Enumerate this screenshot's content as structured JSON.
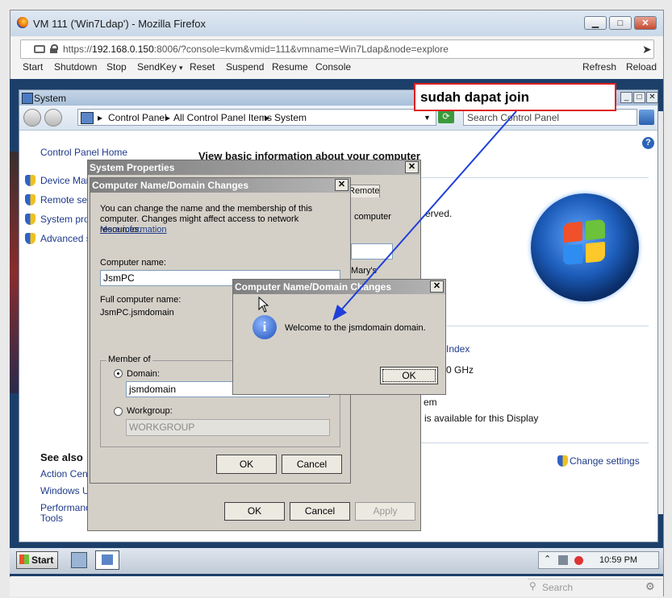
{
  "browser": {
    "window_title": "VM 111 ('Win7Ldap') - Mozilla Firefox",
    "url_prefix": "https://",
    "url_host": "192.168.0.150",
    "url_rest": ":8006/?console=kvm&vmid=111&vmname=Win7Ldap&node=explore",
    "search_placeholder": "Search",
    "buttons": {
      "minimize": "▁",
      "maximize": "□",
      "close": "✕"
    }
  },
  "console_toolbar": {
    "items": [
      "Start",
      "Shutdown",
      "Stop",
      "SendKey",
      "Reset",
      "Suspend",
      "Resume",
      "Console"
    ],
    "right_items": [
      "Refresh",
      "Reload"
    ],
    "sendkey_arrow": "▾"
  },
  "annotation": {
    "text": "sudah dapat join"
  },
  "system_window": {
    "title": "System",
    "breadcrumb": [
      "Control Panel",
      "All Control Panel Items",
      "System"
    ],
    "breadcrumb_sep": "▸",
    "search_placeholder": "Search Control Panel",
    "control_panel_home": "Control Panel Home",
    "left_links": [
      "Device Mana",
      "Remote setti",
      "System prot",
      "Advanced s"
    ],
    "see_also_heading": "See also",
    "see_also_links": [
      "Action Cent",
      "Windows Up",
      "Performance",
      "Tools"
    ],
    "heading": "View basic information about your computer",
    "main_fragments": {
      "reserved": "erved.",
      "index": "Index",
      "ghz": "0 GHz",
      "em": "em",
      "display": "is available for this Display",
      "change_settings": "Change settings"
    },
    "help_icon": "?"
  },
  "system_properties": {
    "title": "System Properties",
    "tab_remote": "Remote",
    "computer_text": "computer",
    "marys_text": "Mary's",
    "ok": "OK",
    "cancel": "Cancel",
    "apply": "Apply",
    "close": "✕"
  },
  "domain_changes": {
    "title": "Computer Name/Domain Changes",
    "description": "You can change the name and the membership of this computer. Changes might affect access to network resources.",
    "more_info": "More information",
    "computer_name_label": "Computer name:",
    "computer_name_value": "JsmPC",
    "full_name_label": "Full computer name:",
    "full_name_value": "JsmPC.jsmdomain",
    "member_of_label": "Member of",
    "domain_label": "Domain:",
    "domain_value": "jsmdomain",
    "workgroup_label": "Workgroup:",
    "workgroup_value": "WORKGROUP",
    "ok": "OK",
    "cancel": "Cancel",
    "close": "✕"
  },
  "welcome_dialog": {
    "title": "Computer Name/Domain Changes",
    "message": "Welcome to the jsmdomain domain.",
    "ok": "OK",
    "close": "✕",
    "info_glyph": "i"
  },
  "taskbar": {
    "start": "Start",
    "clock": "10:59 PM"
  },
  "colors": {
    "accent_red": "#e02020",
    "arrow_blue": "#1f3fd8",
    "link_blue": "#1e3a8a"
  }
}
